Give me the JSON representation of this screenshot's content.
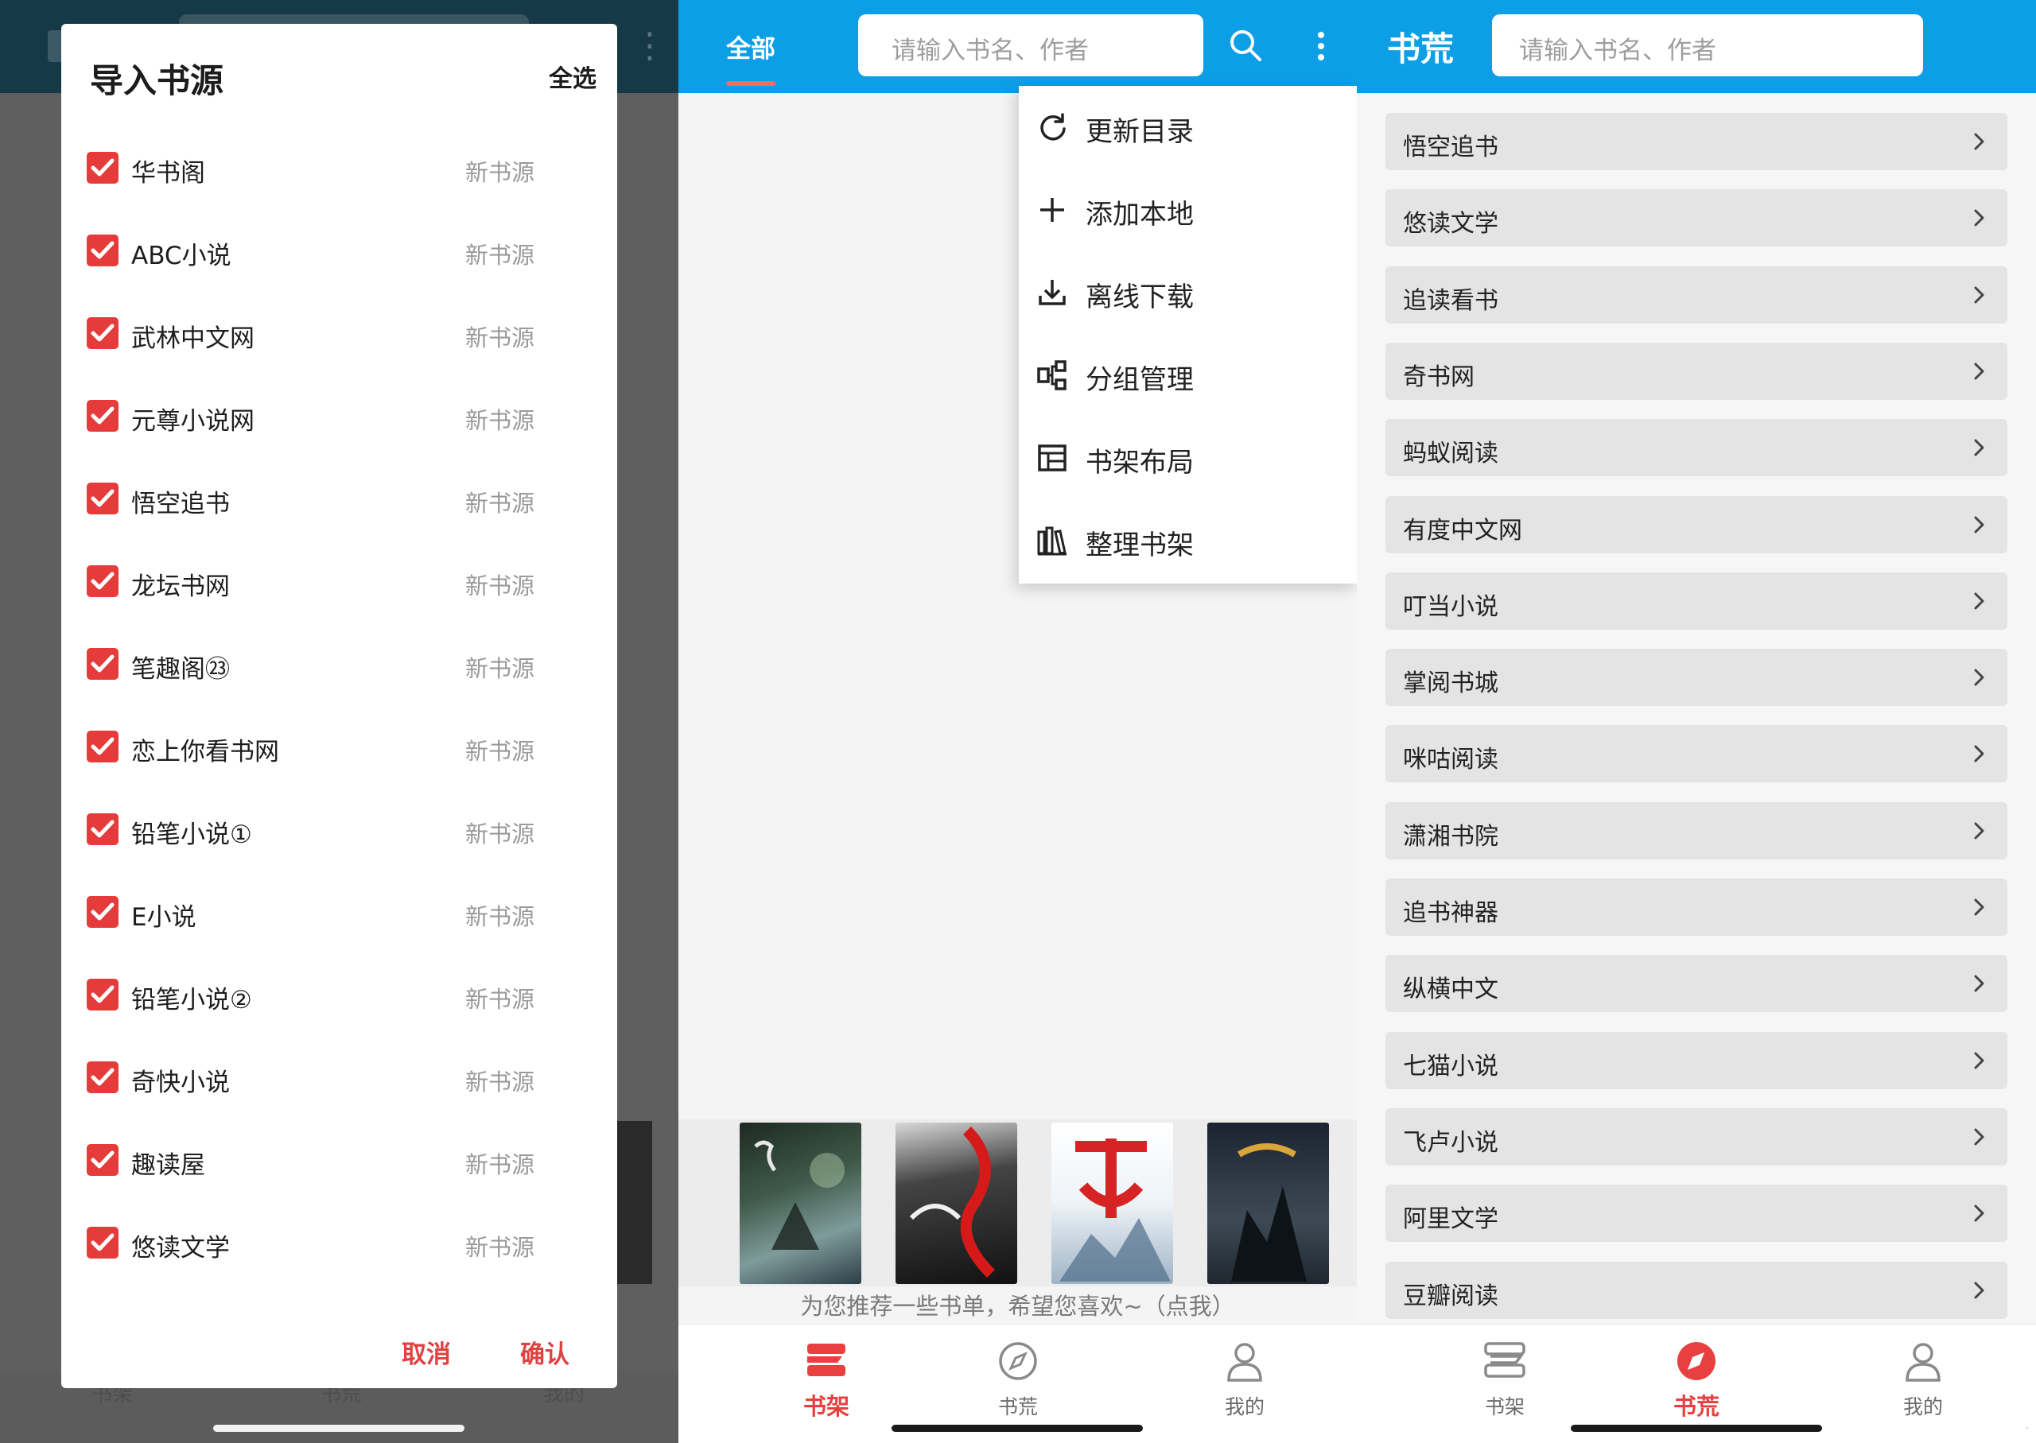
{
  "import_panel": {
    "title": "导入书源",
    "select_all": "全选",
    "sources": [
      {
        "name": "华书阁",
        "tag": "新书源",
        "checked": true
      },
      {
        "name": "ABC小说",
        "tag": "新书源",
        "checked": true
      },
      {
        "name": "武林中文网",
        "tag": "新书源",
        "checked": true
      },
      {
        "name": "元尊小说网",
        "tag": "新书源",
        "checked": true
      },
      {
        "name": "悟空追书",
        "tag": "新书源",
        "checked": true
      },
      {
        "name": "龙坛书网",
        "tag": "新书源",
        "checked": true
      },
      {
        "name": "笔趣阁㉓",
        "tag": "新书源",
        "checked": true
      },
      {
        "name": "恋上你看书网",
        "tag": "新书源",
        "checked": true
      },
      {
        "name": "铅笔小说①",
        "tag": "新书源",
        "checked": true
      },
      {
        "name": "E小说",
        "tag": "新书源",
        "checked": true
      },
      {
        "name": "铅笔小说②",
        "tag": "新书源",
        "checked": true
      },
      {
        "name": "奇快小说",
        "tag": "新书源",
        "checked": true
      },
      {
        "name": "趣读屋",
        "tag": "新书源",
        "checked": true
      },
      {
        "name": "悠读文学",
        "tag": "新书源",
        "checked": true
      }
    ],
    "cancel": "取消",
    "confirm": "确认",
    "background_nav": [
      "书架",
      "书荒",
      "我的"
    ]
  },
  "shelf_panel": {
    "tab_all": "全部",
    "search_placeholder": "请输入书名、作者",
    "menu": [
      {
        "label": "更新目录",
        "icon": "refresh-icon"
      },
      {
        "label": "添加本地",
        "icon": "plus-icon"
      },
      {
        "label": "离线下载",
        "icon": "download-icon"
      },
      {
        "label": "分组管理",
        "icon": "group-icon"
      },
      {
        "label": "书架布局",
        "icon": "layout-icon"
      },
      {
        "label": "整理书架",
        "icon": "books-icon"
      }
    ],
    "recommend_text": "为您推荐一些书单，希望您喜欢~（点我）",
    "nav": [
      {
        "label": "书架",
        "icon": "shelf-icon",
        "active": true
      },
      {
        "label": "书荒",
        "icon": "compass-icon",
        "active": false
      },
      {
        "label": "我的",
        "icon": "user-icon",
        "active": false
      }
    ]
  },
  "discover_panel": {
    "title": "书荒",
    "search_placeholder": "请输入书名、作者",
    "sources": [
      "悟空追书",
      "悠读文学",
      "追读看书",
      "奇书网",
      "蚂蚁阅读",
      "有度中文网",
      "叮当小说",
      "掌阅书城",
      "咪咕阅读",
      "潇湘书院",
      "追书神器",
      "纵横中文",
      "七猫小说",
      "飞卢小说",
      "阿里文学",
      "豆瓣阅读"
    ],
    "nav": [
      {
        "label": "书架",
        "icon": "shelf-icon",
        "active": false
      },
      {
        "label": "书荒",
        "icon": "compass-icon",
        "active": true
      },
      {
        "label": "我的",
        "icon": "user-icon",
        "active": false
      }
    ]
  },
  "colors": {
    "accent_red": "#e53b3b",
    "app_bar_blue": "#0d9fe6",
    "dim_overlay": "#5f5f5f"
  }
}
